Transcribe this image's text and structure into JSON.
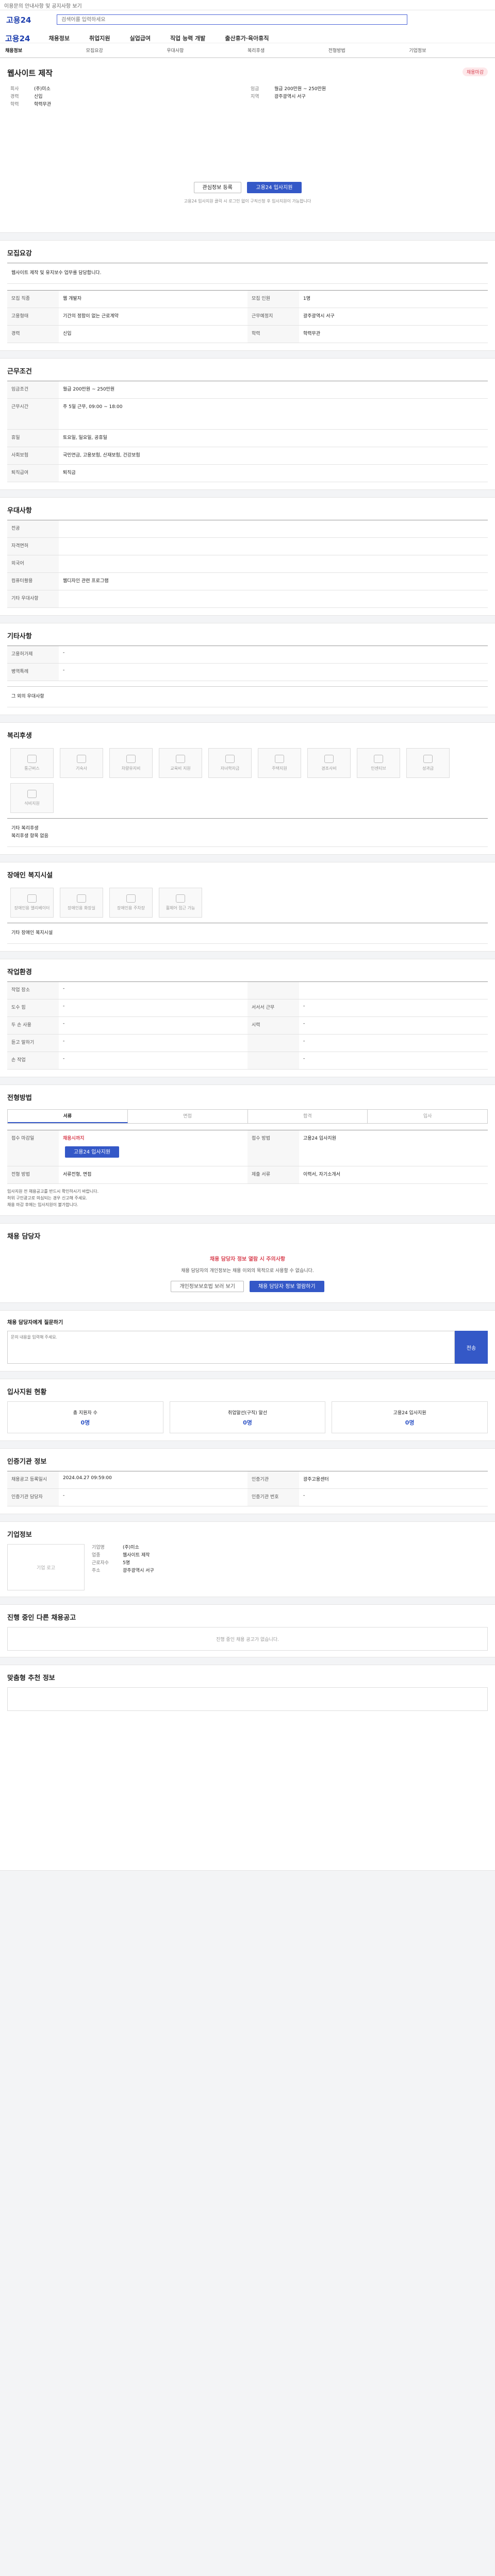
{
  "topbar": {
    "text": "이용문의 안내사항 및 공지사항 보기"
  },
  "search": {
    "placeholder": "검색어를 입력하세요"
  },
  "gnb": {
    "logo": "고용24",
    "items": [
      "채용정보",
      "취업지원",
      "실업급여",
      "직업 능력 개발",
      "출산휴가·육아휴직"
    ]
  },
  "subnav": {
    "items": [
      "채용정보",
      "모집요강",
      "우대사항",
      "복리후생",
      "전형방법",
      "기업정보"
    ]
  },
  "job": {
    "title": "웹사이트 제작",
    "badge": "채용마감",
    "company": "(주)미소",
    "location": "광주광역시 서구",
    "salary": "월급 200만원 ~ 250만원",
    "career": "신입",
    "education": "학력무관",
    "actions": [
      "관심정보 등록",
      "고용24 입사지원"
    ],
    "note": "고용24 입사지원 클릭 시 로그인 없이 구직신청 후 입사지원이 가능합니다"
  },
  "sections": {
    "recruit": {
      "title": "모집요강",
      "desc": "웹사이트 제작 및 유지보수 업무를 담당합니다.",
      "rows": [
        [
          "모집 직종",
          "웹 개발자",
          "모집 인원",
          "1명"
        ],
        [
          "고용형태",
          "기간의 정함이 없는 근로계약",
          "근무예정지",
          "광주광역시 서구"
        ],
        [
          "경력",
          "신입",
          "학력",
          "학력무관"
        ]
      ]
    },
    "work": {
      "title": "근무조건",
      "rows": [
        [
          "임금조건",
          "월급 200만원 ~ 250만원"
        ],
        [
          "근무시간",
          "주 5일 근무, 09:00 ~ 18:00"
        ],
        [
          "휴일",
          "토요일, 일요일, 공휴일"
        ],
        [
          "사회보험",
          "국민연금, 고용보험, 산재보험, 건강보험"
        ],
        [
          "퇴직급여",
          "퇴직금"
        ]
      ]
    },
    "pref": {
      "title": "우대사항",
      "rows": [
        [
          "전공",
          ""
        ],
        [
          "자격면허",
          ""
        ],
        [
          "외국어",
          ""
        ],
        [
          "컴퓨터활용",
          "웹디자인 관련 프로그램"
        ],
        [
          "기타 우대사항",
          ""
        ]
      ]
    },
    "etc": {
      "title": "기타사항",
      "rows": [
        [
          "고용허가제",
          "-"
        ],
        [
          "병역특례",
          "-"
        ]
      ],
      "extra": "그 외의 우대사항"
    },
    "welfare": {
      "title": "복리후생",
      "items": [
        "통근버스",
        "기숙사",
        "차량유지비",
        "교육비 지원",
        "자녀학자금",
        "주택지원",
        "경조사비",
        "인센티브",
        "성과급",
        "식비지원"
      ],
      "extra": "기타 복리후생",
      "extra_val": "복리후생 항목 없음"
    },
    "disabled": {
      "title": "장애인 복지시설",
      "items": [
        "장애인용 엘리베이터",
        "장애인용 화장실",
        "장애인용 주차장",
        "휠체어 접근 가능"
      ],
      "extra": "기타 장애인 복지시설"
    },
    "env": {
      "title": "작업환경",
      "rows": [
        [
          "작업 장소",
          "-",
          "",
          ""
        ],
        [
          "도수 힘",
          "-",
          "서서서 근무",
          "-"
        ],
        [
          "두 손 사용",
          "-",
          "시력",
          "-"
        ],
        [
          "듣고 말하기",
          "-",
          "",
          "-"
        ],
        [
          "손 작업",
          "-",
          "",
          "-"
        ]
      ]
    },
    "process": {
      "title": "전형방법",
      "tabs": [
        "서류",
        "면접",
        "합격",
        "입사"
      ],
      "rows": [
        [
          "접수 마감일",
          "채용시까지",
          "접수 방법",
          "고용24 입사지원"
        ],
        [
          "전형 방법",
          "서류전형, 면접",
          "제출 서류",
          "이력서, 자기소개서"
        ]
      ],
      "apply": "고용24 입사지원",
      "bullets": [
        "입사지원 전 채용공고를 반드시 확인하시기 바랍니다.",
        "허위 구인광고로 의심되는 경우 신고해 주세요.",
        "채용 마감 후에는 입사지원이 불가합니다."
      ]
    },
    "contact": {
      "title": "채용 담당자",
      "warn": "채용 담당자 정보 열람 시 주의사항",
      "msg": "채용 담당자의 개인정보는 채용 이외의 목적으로 사용할 수 없습니다.",
      "buttons": [
        "개인정보보호법 보러 보기",
        "채용 담당자 정보 열람하기"
      ]
    },
    "comments": {
      "title": "채용 담당자에게 질문하기",
      "placeholder": "문의 내용을 입력해 주세요.",
      "send": "전송"
    },
    "stats": {
      "title": "입사지원 현황",
      "boxes": [
        [
          "총 지원자 수",
          "0명"
        ],
        [
          "취업알선(구직) 알선",
          "0명"
        ],
        [
          "고용24 입사지원",
          "0명"
        ]
      ]
    },
    "recruit_info": {
      "title": "인증기관 정보",
      "rows": [
        [
          "채용공고 등록일시",
          "2024.04.27 09:59:00",
          "인증기관",
          "광주고용센터"
        ],
        [
          "인증기관 담당자",
          "-",
          "인증기관 번호",
          "-"
        ]
      ]
    },
    "company": {
      "title": "기업정보",
      "logo": "기업 로고",
      "rows": [
        [
          "기업명",
          "(주)미소"
        ],
        [
          "업종",
          "웹사이트 제작"
        ],
        [
          "근로자수",
          "5명"
        ],
        [
          "주소",
          "광주광역시 서구"
        ]
      ]
    },
    "others": {
      "title": "진행 중인 다른 채용공고",
      "empty": "진행 중인 채용 공고가 없습니다."
    },
    "similar": {
      "title": "맞춤형 추천 정보",
      "empty": ""
    }
  }
}
